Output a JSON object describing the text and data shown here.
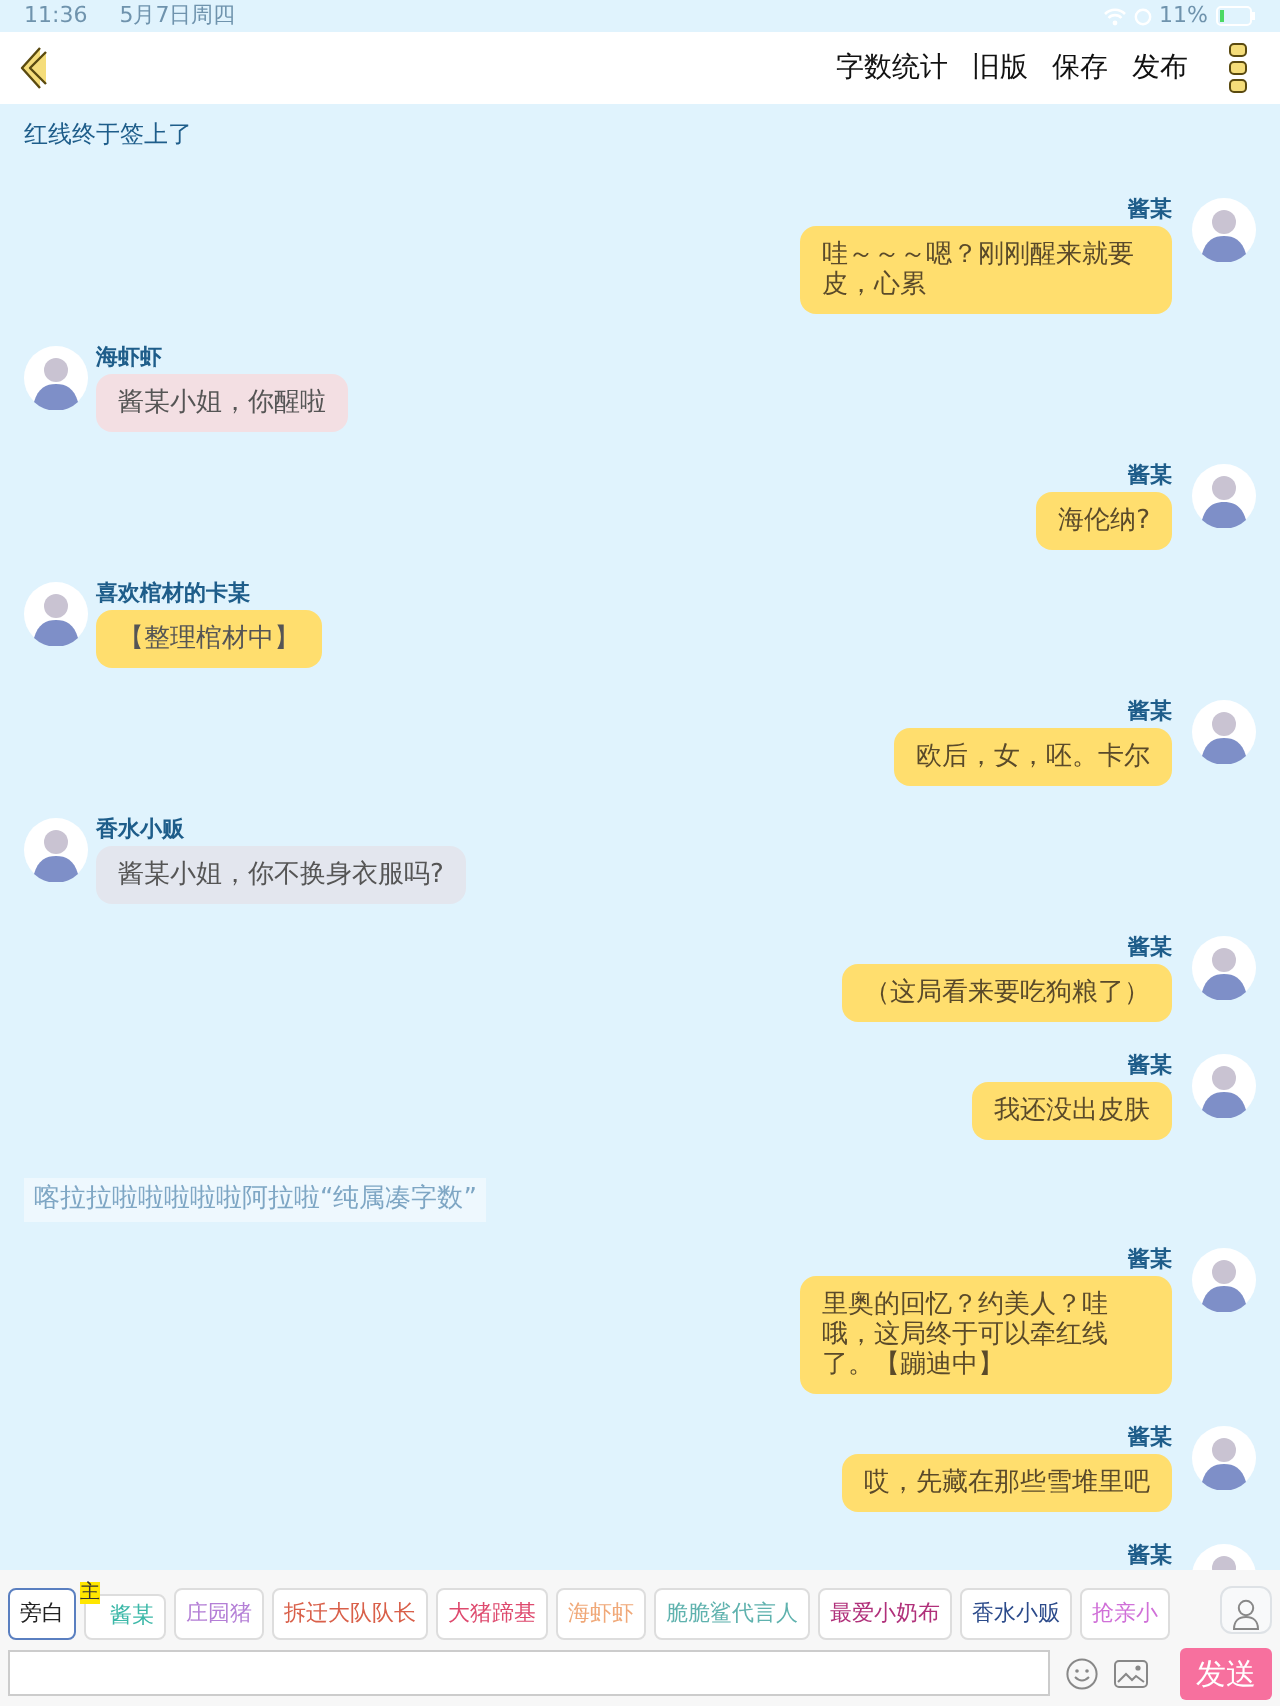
{
  "status_bar": {
    "time": "11:36",
    "date": "5月7日周四",
    "battery": "11%"
  },
  "header": {
    "actions": [
      "字数统计",
      "旧版",
      "保存",
      "发布"
    ]
  },
  "messages": [
    {
      "kind": "narration",
      "text": "红线终于签上了"
    },
    {
      "kind": "right",
      "name": "酱某",
      "text": "哇～～～嗯？刚刚醒来就要皮，心累",
      "color": "#ffde6e"
    },
    {
      "kind": "left",
      "name": "海虾虾",
      "text": "酱某小姐，你醒啦",
      "color": "#f3dfe3"
    },
    {
      "kind": "right",
      "name": "酱某",
      "text": "海伦纳?",
      "color": "#ffde6e"
    },
    {
      "kind": "left",
      "name": "喜欢棺材的卡某",
      "text": "【整理棺材中】",
      "color": "#ffde6e"
    },
    {
      "kind": "right",
      "name": "酱某",
      "text": "欧后，女，呸。卡尔",
      "color": "#ffde6e"
    },
    {
      "kind": "left",
      "name": "香水小贩",
      "text": "酱某小姐，你不换身衣服吗?",
      "color": "#e3e6ee"
    },
    {
      "kind": "right",
      "name": "酱某",
      "text": "（这局看来要吃狗粮了）",
      "color": "#ffde6e"
    },
    {
      "kind": "right",
      "name": "酱某",
      "text": "我还没出皮肤",
      "color": "#ffde6e"
    },
    {
      "kind": "aside",
      "text": "喀拉拉啦啦啦啦啦阿拉啦“纯属凑字数”"
    },
    {
      "kind": "right",
      "name": "酱某",
      "text": "里奥的回忆？约美人？哇哦，这局终于可以牵红线了。【蹦迪中】",
      "color": "#ffde6e"
    },
    {
      "kind": "right",
      "name": "酱某",
      "text": "哎，先藏在那些雪堆里吧",
      "color": "#ffde6e"
    },
    {
      "kind": "right",
      "name": "酱某"
    }
  ],
  "characters": [
    {
      "label": "旁白",
      "selected": true,
      "color": "#222222"
    },
    {
      "label": "酱某",
      "selected": false,
      "color": "#3cb8a8",
      "badge": "主"
    },
    {
      "label": "庄园猪",
      "selected": false,
      "color": "#b47fd6"
    },
    {
      "label": "拆迁大队队长",
      "selected": false,
      "color": "#d9604a"
    },
    {
      "label": "大猪蹄基",
      "selected": false,
      "color": "#de4a6e"
    },
    {
      "label": "海虾虾",
      "selected": false,
      "color": "#f0a878"
    },
    {
      "label": "脆脆鲨代言人",
      "selected": false,
      "color": "#5fb2ae"
    },
    {
      "label": "最爱小奶布",
      "selected": false,
      "color": "#b0307a"
    },
    {
      "label": "香水小贩",
      "selected": false,
      "color": "#2b4a8a"
    },
    {
      "label": "抢亲小",
      "selected": false,
      "color": "#d070d8"
    }
  ],
  "composer": {
    "send": "发送"
  }
}
